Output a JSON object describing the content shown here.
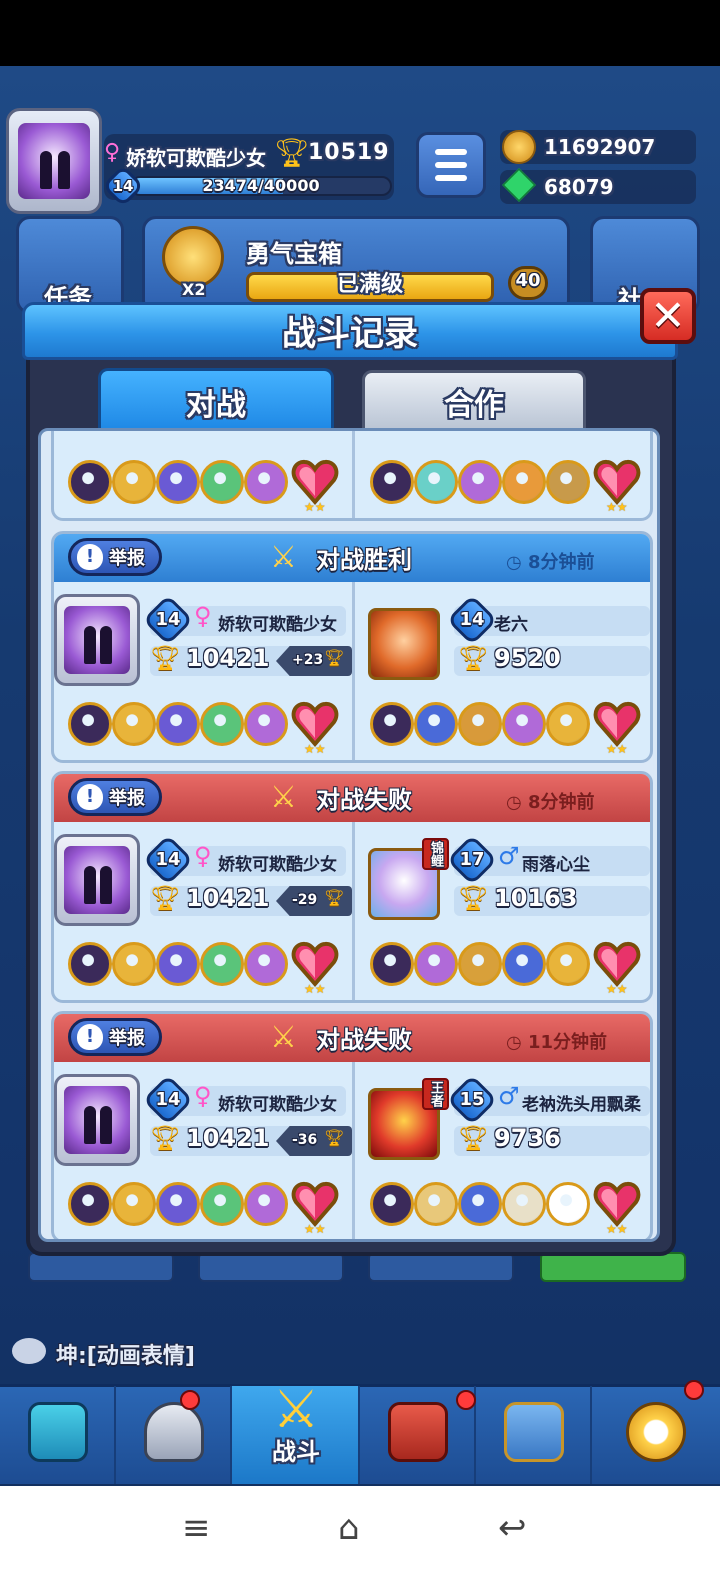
{
  "player": {
    "name": "娇软可欺酷少女",
    "trophies": "10519",
    "level": "14",
    "xp_text": "23474/40000",
    "xp_fraction": 0.587
  },
  "currency": {
    "coins": "11692907",
    "gems": "68079"
  },
  "background": {
    "task_label": "任务",
    "chest_title": "勇气宝箱",
    "chest_status": "已满级",
    "chest_multiplier": "X2",
    "chest_badge": "40",
    "social_label": "社"
  },
  "modal": {
    "title": "战斗记录",
    "tabs": [
      {
        "label": "对战",
        "active": true
      },
      {
        "label": "合作",
        "active": false
      }
    ],
    "close_icon": "close-icon"
  },
  "records": [
    {
      "report_label": "举报",
      "result": "对战胜利",
      "status": "win",
      "time": "8分钟前",
      "me": {
        "level": "14",
        "name": "娇软可欺酷少女",
        "gender": "♀",
        "trophies": "10421",
        "delta": "+23"
      },
      "opponent": {
        "level": "14",
        "name": "老六",
        "gender": "",
        "trophies": "9520",
        "badge": ""
      }
    },
    {
      "report_label": "举报",
      "result": "对战失败",
      "status": "lose",
      "time": "8分钟前",
      "me": {
        "level": "14",
        "name": "娇软可欺酷少女",
        "gender": "♀",
        "trophies": "10421",
        "delta": "-29"
      },
      "opponent": {
        "level": "17",
        "name": "雨落心尘",
        "gender": "♂",
        "trophies": "10163",
        "badge": "锦鲤"
      }
    },
    {
      "report_label": "举报",
      "result": "对战失败",
      "status": "lose",
      "time": "11分钟前",
      "me": {
        "level": "14",
        "name": "娇软可欺酷少女",
        "gender": "♀",
        "trophies": "10421",
        "delta": "-36"
      },
      "opponent": {
        "level": "15",
        "name": "老衲洗头用飘柔",
        "gender": "♂",
        "trophies": "9736",
        "badge": "王者"
      }
    }
  ],
  "chat": {
    "text": "坤:[动画表情]"
  },
  "nav": {
    "items": [
      "chest-icon",
      "helmet-icon",
      "battle-icon",
      "crown-shield-icon",
      "team-icon",
      "compass-icon"
    ],
    "active_label": "战斗"
  },
  "colors": {
    "win": "#2e7fd2",
    "lose": "#c24444",
    "accent": "#1e88e5"
  }
}
